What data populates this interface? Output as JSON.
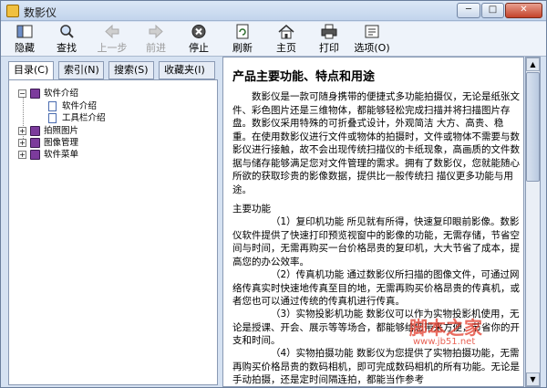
{
  "window": {
    "title": "数影仪"
  },
  "toolbar": {
    "hide": "隐藏",
    "find": "查找",
    "back": "上一步",
    "forward": "前进",
    "stop": "停止",
    "refresh": "刷新",
    "home": "主页",
    "print": "打印",
    "options": "选项(O)"
  },
  "tabs": [
    "目录(C)",
    "索引(N)",
    "搜索(S)",
    "收藏夹(I)"
  ],
  "tree": {
    "root": "软件介绍",
    "children": [
      "软件介绍",
      "工具栏介绍"
    ],
    "items": [
      "拍照图片",
      "图像管理",
      "软件菜单"
    ]
  },
  "content": {
    "heading": "产品主要功能、特点和用途",
    "intro": "数影仪是一款可随身携带的便捷式多功能拍摄仪，无论是纸张文件、彩色图片还是三维物体，都能够轻松完成扫描并将扫描图片存盘。数影仪采用特殊的可折叠式设计，外观简洁 大方、高贵、稳重。在使用数影仪进行文件或物体的拍摄时，文件或物体不需要与数影仪进行接触，故不会出现传统扫描仪的卡纸现象，高画质的文件数据与储存能够满足您对文件管理的需求。拥有了数影仪，您就能随心所欲的获取珍贵的影像数据，提供比一般传统扫 描仪更多功能与用途。",
    "section": "主要功能",
    "p1": "（1）复印机功能 所见就有所得，快速复印眼前影像。数影仪软件提供了快速打印预览视窗中的影像的功能，无需存储，节省空间与时间，无需再购买一台价格昂贵的复印机，大大节省了成本，提 高您的办公效率。",
    "p2": "（2）传真机功能 通过数影仪所扫描的图像文件，可通过网络传真实时快速地传真至目的地，无需再购买价格昂贵的传真机，或者您也可以通过传统的传真机进行传真。",
    "p3": "（3）实物投影机功能 数影仪可以作为实物投影机使用，无论是授课、开会、展示等等场合，都能够给您带来方便，节省你的开支和时间。",
    "p4": "（4）实物拍摄功能 数影仪为您提供了实物拍摄功能，无需再购买价格昂贵的数码相机，即可完成数码相机的所有功能。无论是手动拍摄，还是定时间隔连拍，都能当作参考"
  },
  "watermark": {
    "text": "脚本之家",
    "sub": "www.jb51.net"
  },
  "colors": {
    "accent": "#7c3b9c",
    "title_bg": "#c2d4ec"
  }
}
